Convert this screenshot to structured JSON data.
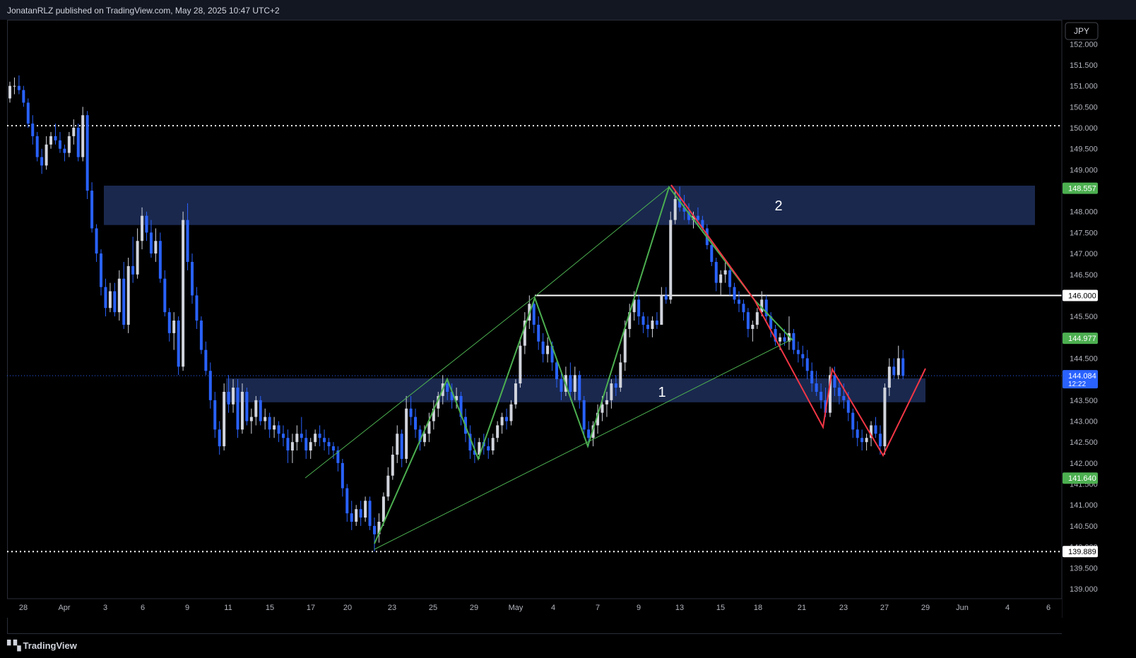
{
  "header": {
    "published": "JonatanRLZ published on TradingView.com, May 28, 2025 10:47 UTC+2"
  },
  "footer": {
    "brand": "TradingView",
    "logo_icon": "tradingview-logo-icon"
  },
  "currency": "JPY",
  "colors": {
    "up_candle": "#d1d4dc",
    "down_candle": "#2962ff",
    "zone_fill": "#1e2f5c",
    "green_line": "#4caf50",
    "red_line": "#f23645",
    "level_line": "#ffffff",
    "label_green": "#4caf50",
    "label_blue": "#2962ff"
  },
  "chart_data": {
    "type": "candlestick",
    "title": "",
    "symbol_currency": "JPY",
    "ylim": [
      138.7,
      152.3
    ],
    "y_ticks": [
      "152.000",
      "151.500",
      "151.000",
      "150.500",
      "150.000",
      "149.500",
      "149.000",
      "148.000",
      "147.500",
      "147.000",
      "146.500",
      "145.500",
      "145.000",
      "144.500",
      "143.500",
      "143.000",
      "142.500",
      "142.000",
      "141.500",
      "141.000",
      "140.500",
      "140.000",
      "139.500",
      "139.000"
    ],
    "x_ticks": [
      "28",
      "Apr",
      "3",
      "6",
      "9",
      "11",
      "15",
      "17",
      "20",
      "23",
      "25",
      "29",
      "May",
      "4",
      "7",
      "9",
      "13",
      "15",
      "18",
      "21",
      "23",
      "27",
      "29",
      "Jun",
      "4",
      "6"
    ],
    "price_labels": [
      {
        "value": "148.557",
        "color": "green"
      },
      {
        "value": "146.000",
        "color": "white"
      },
      {
        "value": "144.977",
        "color": "green"
      },
      {
        "value": "144.084",
        "sub": "12:22",
        "color": "blue"
      },
      {
        "value": "141.640",
        "color": "green"
      },
      {
        "value": "139.889",
        "color": "white"
      }
    ],
    "horizontal_levels": [
      {
        "value": 150.05,
        "style": "dotted"
      },
      {
        "value": 139.889,
        "style": "dotted"
      },
      {
        "value": 146.0,
        "style": "solid"
      },
      {
        "value": 144.084,
        "style": "dotted-current"
      }
    ],
    "zones": [
      {
        "label": "2",
        "low": 147.68,
        "high": 148.62
      },
      {
        "label": "1",
        "low": 143.45,
        "high": 144.02
      }
    ],
    "candles": [
      [
        0,
        150.7,
        151.1,
        150.6,
        151.0
      ],
      [
        1,
        151.0,
        151.2,
        150.8,
        151.0
      ],
      [
        2,
        151.0,
        151.25,
        150.8,
        150.9
      ],
      [
        3,
        150.9,
        151.0,
        150.5,
        150.6
      ],
      [
        4,
        150.6,
        150.7,
        150.0,
        150.1
      ],
      [
        5,
        150.1,
        150.3,
        149.6,
        149.8
      ],
      [
        6,
        149.8,
        149.9,
        149.2,
        149.3
      ],
      [
        7,
        149.3,
        149.5,
        148.9,
        149.1
      ],
      [
        8,
        149.1,
        149.8,
        149.0,
        149.6
      ],
      [
        9,
        149.6,
        149.9,
        149.5,
        149.8
      ],
      [
        10,
        149.8,
        150.1,
        149.6,
        149.7
      ],
      [
        11,
        149.7,
        149.9,
        149.4,
        149.5
      ],
      [
        12,
        149.5,
        149.6,
        149.2,
        149.4
      ],
      [
        13,
        149.4,
        149.9,
        149.3,
        149.8
      ],
      [
        14,
        149.8,
        150.2,
        149.6,
        150.0
      ],
      [
        15,
        150.0,
        150.1,
        149.2,
        149.3
      ],
      [
        16,
        149.3,
        150.5,
        149.2,
        150.3
      ],
      [
        17,
        150.3,
        150.4,
        148.3,
        148.5
      ],
      [
        18,
        148.5,
        148.7,
        147.5,
        147.6
      ],
      [
        19,
        147.6,
        147.7,
        146.8,
        147.0
      ],
      [
        20,
        147.0,
        147.1,
        146.0,
        146.2
      ],
      [
        21,
        146.2,
        146.4,
        145.5,
        145.7
      ],
      [
        22,
        145.7,
        146.3,
        145.6,
        146.1
      ],
      [
        23,
        146.1,
        146.3,
        145.5,
        145.6
      ],
      [
        24,
        145.6,
        146.6,
        145.4,
        146.4
      ],
      [
        25,
        146.4,
        146.8,
        145.2,
        145.3
      ],
      [
        26,
        145.3,
        146.9,
        145.1,
        146.7
      ],
      [
        27,
        146.7,
        147.4,
        146.3,
        146.5
      ],
      [
        28,
        146.5,
        147.6,
        146.4,
        147.3
      ],
      [
        29,
        147.3,
        148.1,
        147.1,
        147.9
      ],
      [
        30,
        147.9,
        148.0,
        147.3,
        147.5
      ],
      [
        31,
        147.5,
        147.8,
        146.9,
        147.0
      ],
      [
        32,
        147.0,
        147.6,
        146.8,
        147.3
      ],
      [
        33,
        147.3,
        147.5,
        146.3,
        146.4
      ],
      [
        34,
        146.4,
        146.6,
        145.5,
        145.6
      ],
      [
        35,
        145.6,
        145.7,
        144.9,
        145.1
      ],
      [
        36,
        145.1,
        145.6,
        144.7,
        145.4
      ],
      [
        37,
        145.4,
        145.5,
        144.1,
        144.3
      ],
      [
        38,
        144.3,
        148.0,
        144.2,
        147.8
      ],
      [
        39,
        147.8,
        148.2,
        146.6,
        146.8
      ],
      [
        40,
        146.8,
        147.0,
        145.8,
        146.0
      ],
      [
        41,
        146.0,
        146.2,
        145.2,
        145.4
      ],
      [
        42,
        145.4,
        145.5,
        144.6,
        144.7
      ],
      [
        43,
        144.7,
        144.9,
        144.1,
        144.2
      ],
      [
        44,
        144.2,
        144.4,
        143.3,
        143.5
      ],
      [
        45,
        143.5,
        143.7,
        142.6,
        142.8
      ],
      [
        46,
        142.8,
        143.0,
        142.2,
        142.4
      ],
      [
        47,
        142.4,
        143.9,
        142.3,
        143.7
      ],
      [
        48,
        143.7,
        144.1,
        143.2,
        143.4
      ],
      [
        49,
        143.4,
        144.0,
        143.2,
        143.8
      ],
      [
        50,
        143.8,
        144.0,
        142.6,
        142.8
      ],
      [
        51,
        142.8,
        143.9,
        142.7,
        143.7
      ],
      [
        52,
        143.7,
        143.8,
        142.9,
        143.0
      ],
      [
        53,
        143.0,
        143.3,
        142.7,
        143.1
      ],
      [
        54,
        143.1,
        143.6,
        142.9,
        143.5
      ],
      [
        55,
        143.5,
        143.6,
        142.9,
        143.0
      ],
      [
        56,
        143.0,
        143.3,
        142.8,
        143.1
      ],
      [
        57,
        143.1,
        143.2,
        142.6,
        142.8
      ],
      [
        58,
        142.8,
        143.1,
        142.6,
        142.9
      ],
      [
        59,
        142.9,
        143.0,
        142.5,
        142.7
      ],
      [
        60,
        142.7,
        142.9,
        142.4,
        142.6
      ],
      [
        61,
        142.6,
        142.8,
        142.0,
        142.3
      ],
      [
        62,
        142.3,
        142.7,
        142.0,
        142.5
      ],
      [
        63,
        142.5,
        142.9,
        142.3,
        142.7
      ],
      [
        64,
        142.7,
        143.1,
        142.5,
        142.6
      ],
      [
        65,
        142.6,
        142.8,
        142.1,
        142.3
      ],
      [
        66,
        142.3,
        142.6,
        142.1,
        142.5
      ],
      [
        67,
        142.5,
        142.8,
        142.4,
        142.7
      ],
      [
        68,
        142.7,
        142.9,
        142.4,
        142.6
      ],
      [
        69,
        142.6,
        142.8,
        142.3,
        142.5
      ],
      [
        70,
        142.5,
        142.6,
        142.2,
        142.4
      ],
      [
        71,
        142.4,
        142.5,
        142.1,
        142.3
      ],
      [
        72,
        142.3,
        142.4,
        141.8,
        142.0
      ],
      [
        73,
        142.0,
        142.1,
        141.2,
        141.4
      ],
      [
        74,
        141.4,
        141.5,
        140.6,
        140.8
      ],
      [
        75,
        140.8,
        141.1,
        140.4,
        140.6
      ],
      [
        76,
        140.6,
        141.0,
        140.5,
        140.9
      ],
      [
        77,
        140.9,
        141.1,
        140.5,
        140.7
      ],
      [
        78,
        140.7,
        141.2,
        140.6,
        141.1
      ],
      [
        79,
        141.1,
        141.2,
        140.4,
        140.5
      ],
      [
        80,
        140.5,
        140.7,
        139.89,
        140.3
      ],
      [
        81,
        140.3,
        140.8,
        140.1,
        140.6
      ],
      [
        82,
        140.6,
        141.3,
        140.5,
        141.2
      ],
      [
        83,
        141.2,
        141.9,
        141.1,
        141.7
      ],
      [
        84,
        141.7,
        142.4,
        141.6,
        142.2
      ],
      [
        85,
        142.2,
        142.9,
        142.0,
        142.7
      ],
      [
        86,
        142.7,
        142.8,
        141.9,
        142.1
      ],
      [
        87,
        142.1,
        143.6,
        142.0,
        143.3
      ],
      [
        88,
        143.3,
        143.6,
        142.9,
        143.1
      ],
      [
        89,
        143.1,
        143.3,
        142.6,
        142.8
      ],
      [
        90,
        142.8,
        142.9,
        142.3,
        142.5
      ],
      [
        91,
        142.5,
        142.9,
        142.4,
        142.7
      ],
      [
        92,
        142.7,
        143.2,
        142.5,
        143.0
      ],
      [
        93,
        143.0,
        143.5,
        142.8,
        143.3
      ],
      [
        94,
        143.3,
        143.7,
        143.1,
        143.6
      ],
      [
        95,
        143.6,
        144.1,
        143.4,
        143.9
      ],
      [
        96,
        143.9,
        144.0,
        143.5,
        143.7
      ],
      [
        97,
        143.7,
        143.9,
        143.3,
        143.5
      ],
      [
        98,
        143.5,
        143.8,
        143.3,
        143.6
      ],
      [
        99,
        143.6,
        143.7,
        142.9,
        143.1
      ],
      [
        100,
        143.1,
        143.3,
        142.5,
        142.7
      ],
      [
        101,
        142.7,
        142.9,
        142.1,
        142.3
      ],
      [
        102,
        142.3,
        142.6,
        142.0,
        142.2
      ],
      [
        103,
        142.2,
        142.6,
        142.1,
        142.5
      ],
      [
        104,
        142.5,
        142.7,
        142.2,
        142.4
      ],
      [
        105,
        142.4,
        142.6,
        142.1,
        142.3
      ],
      [
        106,
        142.3,
        142.7,
        142.2,
        142.6
      ],
      [
        107,
        142.6,
        143.0,
        142.5,
        142.9
      ],
      [
        108,
        142.9,
        143.2,
        142.7,
        143.1
      ],
      [
        109,
        143.1,
        143.3,
        142.8,
        143.0
      ],
      [
        110,
        143.0,
        143.5,
        142.9,
        143.4
      ],
      [
        111,
        143.4,
        144.0,
        143.3,
        143.9
      ],
      [
        112,
        143.9,
        145.0,
        143.8,
        144.8
      ],
      [
        113,
        144.8,
        145.6,
        144.6,
        145.4
      ],
      [
        114,
        145.4,
        146.0,
        145.2,
        145.8
      ],
      [
        115,
        145.8,
        145.9,
        145.1,
        145.3
      ],
      [
        116,
        145.3,
        145.5,
        144.7,
        144.9
      ],
      [
        117,
        144.9,
        145.1,
        144.4,
        144.6
      ],
      [
        118,
        144.6,
        145.0,
        144.4,
        144.8
      ],
      [
        119,
        144.8,
        144.9,
        144.2,
        144.4
      ],
      [
        120,
        144.4,
        144.5,
        143.8,
        144.0
      ],
      [
        121,
        144.0,
        144.2,
        143.5,
        143.7
      ],
      [
        122,
        143.7,
        144.3,
        143.6,
        144.1
      ],
      [
        123,
        144.1,
        144.4,
        143.5,
        143.7
      ],
      [
        124,
        143.7,
        144.3,
        143.5,
        144.1
      ],
      [
        125,
        144.1,
        144.2,
        143.3,
        143.5
      ],
      [
        126,
        143.5,
        143.6,
        142.6,
        142.8
      ],
      [
        127,
        142.8,
        143.0,
        142.4,
        142.6
      ],
      [
        128,
        142.6,
        143.0,
        142.4,
        142.9
      ],
      [
        129,
        142.9,
        143.4,
        142.7,
        143.2
      ],
      [
        130,
        143.2,
        143.6,
        143.0,
        143.4
      ],
      [
        131,
        143.4,
        143.7,
        143.1,
        143.5
      ],
      [
        132,
        143.5,
        144.0,
        143.3,
        143.9
      ],
      [
        133,
        143.9,
        144.1,
        143.6,
        143.8
      ],
      [
        134,
        143.8,
        144.6,
        143.7,
        144.4
      ],
      [
        135,
        144.4,
        145.4,
        144.2,
        145.2
      ],
      [
        136,
        145.2,
        145.8,
        145.0,
        145.6
      ],
      [
        137,
        145.6,
        146.1,
        145.4,
        145.9
      ],
      [
        138,
        145.9,
        146.0,
        145.3,
        145.5
      ],
      [
        139,
        145.5,
        145.6,
        145.1,
        145.3
      ],
      [
        140,
        145.3,
        145.5,
        145.0,
        145.2
      ],
      [
        141,
        145.2,
        145.5,
        145.0,
        145.4
      ],
      [
        142,
        145.4,
        145.6,
        145.2,
        145.3
      ],
      [
        143,
        145.3,
        146.2,
        145.9,
        146.0
      ],
      [
        144,
        146.0,
        146.2,
        145.8,
        145.9
      ],
      [
        145,
        145.9,
        148.0,
        145.8,
        147.8
      ],
      [
        146,
        147.8,
        148.5,
        147.7,
        148.3
      ],
      [
        147,
        148.3,
        148.6,
        148.0,
        148.1
      ],
      [
        148,
        148.1,
        148.4,
        147.8,
        148.0
      ],
      [
        149,
        148.0,
        148.2,
        147.7,
        147.8
      ],
      [
        150,
        147.8,
        148.0,
        147.6,
        147.9
      ],
      [
        151,
        147.9,
        148.1,
        147.7,
        147.8
      ],
      [
        152,
        147.8,
        147.9,
        147.5,
        147.6
      ],
      [
        153,
        147.6,
        147.7,
        147.1,
        147.2
      ],
      [
        154,
        147.2,
        147.3,
        146.7,
        146.8
      ],
      [
        155,
        146.8,
        146.9,
        146.1,
        146.3
      ],
      [
        156,
        146.3,
        146.6,
        146.0,
        146.5
      ],
      [
        157,
        146.5,
        146.8,
        146.3,
        146.6
      ],
      [
        158,
        146.6,
        146.7,
        146.0,
        146.2
      ],
      [
        159,
        146.2,
        146.3,
        145.8,
        145.9
      ],
      [
        160,
        145.9,
        146.1,
        145.6,
        145.8
      ],
      [
        161,
        145.8,
        145.9,
        145.4,
        145.6
      ],
      [
        162,
        145.6,
        145.7,
        145.0,
        145.2
      ],
      [
        163,
        145.2,
        145.4,
        144.9,
        145.3
      ],
      [
        164,
        145.3,
        145.7,
        145.2,
        145.6
      ],
      [
        165,
        145.6,
        146.1,
        145.5,
        145.9
      ],
      [
        166,
        145.9,
        146.0,
        145.4,
        145.5
      ],
      [
        167,
        145.5,
        145.6,
        145.0,
        145.2
      ],
      [
        168,
        145.2,
        145.3,
        144.8,
        144.9
      ],
      [
        169,
        144.9,
        145.1,
        144.7,
        145.0
      ],
      [
        170,
        145.0,
        145.2,
        144.8,
        144.9
      ],
      [
        171,
        144.9,
        145.5,
        144.7,
        145.1
      ],
      [
        172,
        145.1,
        145.2,
        144.6,
        144.7
      ],
      [
        173,
        144.7,
        144.9,
        144.4,
        144.6
      ],
      [
        174,
        144.6,
        144.8,
        144.3,
        144.5
      ],
      [
        175,
        144.5,
        144.7,
        144.0,
        144.2
      ],
      [
        176,
        144.2,
        144.4,
        143.7,
        143.9
      ],
      [
        177,
        143.9,
        144.2,
        143.6,
        143.7
      ],
      [
        178,
        143.7,
        143.9,
        143.3,
        143.5
      ],
      [
        179,
        143.5,
        143.8,
        143.1,
        143.2
      ],
      [
        180,
        143.2,
        144.3,
        143.1,
        144.1
      ],
      [
        181,
        144.1,
        144.3,
        143.6,
        143.8
      ],
      [
        182,
        143.8,
        144.0,
        143.4,
        143.6
      ],
      [
        183,
        143.6,
        143.9,
        143.3,
        143.5
      ],
      [
        184,
        143.5,
        143.7,
        143.0,
        143.2
      ],
      [
        185,
        143.2,
        143.3,
        142.6,
        142.8
      ],
      [
        186,
        142.8,
        143.0,
        142.4,
        142.6
      ],
      [
        187,
        142.6,
        142.8,
        142.3,
        142.5
      ],
      [
        188,
        142.5,
        142.7,
        142.3,
        142.6
      ],
      [
        189,
        142.6,
        143.0,
        142.4,
        142.9
      ],
      [
        190,
        142.9,
        143.1,
        142.6,
        142.7
      ],
      [
        191,
        142.7,
        142.9,
        142.2,
        142.4
      ],
      [
        192,
        142.4,
        143.9,
        142.2,
        143.8
      ],
      [
        193,
        143.8,
        144.5,
        143.6,
        144.3
      ],
      [
        194,
        144.3,
        144.5,
        144.0,
        144.1
      ],
      [
        195,
        144.1,
        144.8,
        144.0,
        144.5
      ],
      [
        196,
        144.5,
        144.7,
        144.0,
        144.08
      ]
    ],
    "annotations": [
      {
        "type": "text",
        "text": "2"
      },
      {
        "type": "text",
        "text": "1"
      }
    ]
  }
}
